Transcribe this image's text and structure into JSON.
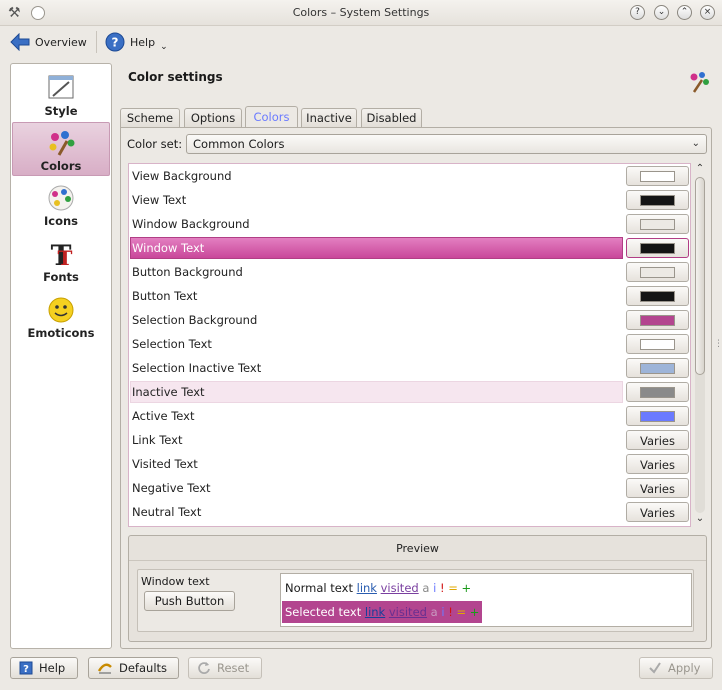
{
  "window": {
    "title": "Colors – System Settings"
  },
  "toolbar": {
    "overview_label": "Overview",
    "help_label": "Help"
  },
  "sidebar": {
    "items": [
      {
        "label": "Style"
      },
      {
        "label": "Colors",
        "selected": true
      },
      {
        "label": "Icons"
      },
      {
        "label": "Fonts"
      },
      {
        "label": "Emoticons"
      }
    ]
  },
  "header": {
    "title": "Color settings"
  },
  "tabs": [
    {
      "label": "Scheme"
    },
    {
      "label": "Options"
    },
    {
      "label": "Colors",
      "active": true
    },
    {
      "label": "Inactive"
    },
    {
      "label": "Disabled"
    }
  ],
  "colorset": {
    "label": "Color set:",
    "value": "Common Colors"
  },
  "color_rows": [
    {
      "name": "View Background",
      "color": "#ffffff"
    },
    {
      "name": "View Text",
      "color": "#141414"
    },
    {
      "name": "Window Background",
      "color": "#ece9e4"
    },
    {
      "name": "Window Text",
      "color": "#141414",
      "selected": true
    },
    {
      "name": "Button Background",
      "color": "#ece9e4"
    },
    {
      "name": "Button Text",
      "color": "#141414"
    },
    {
      "name": "Selection Background",
      "color": "#b3458f"
    },
    {
      "name": "Selection Text",
      "color": "#ffffff"
    },
    {
      "name": "Selection Inactive Text",
      "color": "#9db4d8"
    },
    {
      "name": "Inactive Text",
      "color": "#8a8a8a",
      "hover": true
    },
    {
      "name": "Active Text",
      "color": "#6a7aff"
    },
    {
      "name": "Link Text",
      "value": "Varies"
    },
    {
      "name": "Visited Text",
      "value": "Varies"
    },
    {
      "name": "Negative Text",
      "value": "Varies"
    },
    {
      "name": "Neutral Text",
      "value": "Varies"
    }
  ],
  "preview": {
    "title": "Preview",
    "window_text": "Window text",
    "push_button": "Push Button",
    "normal_text": "Normal text",
    "selected_text": "Selected text",
    "link": "link",
    "visited": "visited",
    "a": "a",
    "i": "i",
    "bang": "!",
    "eq": "=",
    "plus": "+"
  },
  "bottom": {
    "help": "Help",
    "defaults": "Defaults",
    "reset": "Reset",
    "apply": "Apply"
  },
  "colors": {
    "accent": "#b3458f",
    "selection_gradient_top": "#e37fc1"
  }
}
